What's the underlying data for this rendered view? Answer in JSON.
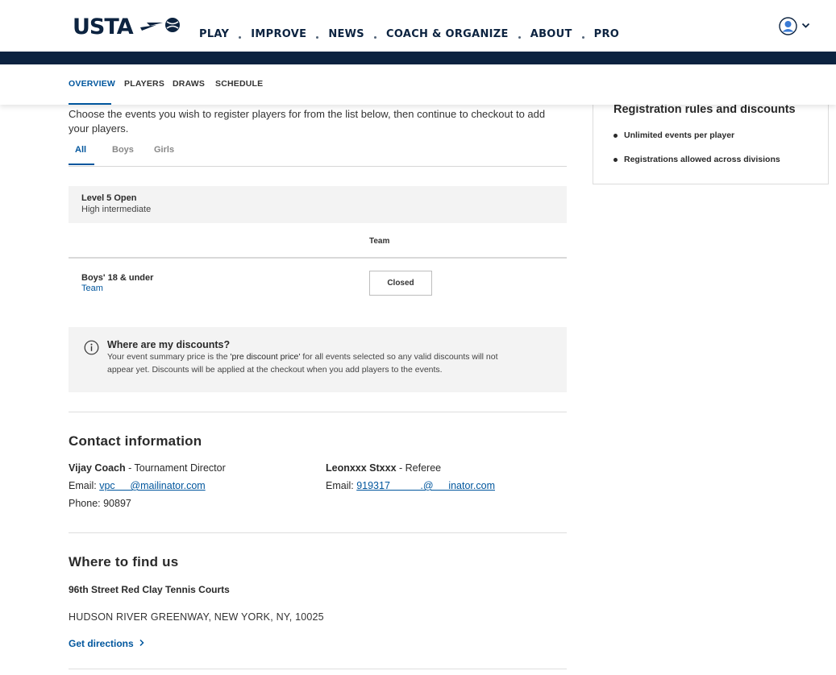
{
  "brand": {
    "logo_text": "USTA"
  },
  "header": {
    "nav": [
      "PLAY",
      "IMPROVE",
      "NEWS",
      "COACH & ORGANIZE",
      "ABOUT",
      "PRO"
    ]
  },
  "subnav": {
    "items": [
      "OVERVIEW",
      "PLAYERS",
      "DRAWS",
      "SCHEDULE"
    ],
    "active": "OVERVIEW"
  },
  "intro": {
    "text": "Choose the events you wish to register players for from the list below, then continue to checkout to add your players."
  },
  "tabs": {
    "items": [
      "All",
      "Boys",
      "Girls"
    ],
    "active": "All"
  },
  "level": {
    "name": "Level 5 Open",
    "description": "High intermediate"
  },
  "events_table": {
    "column_header": "Team",
    "rows": [
      {
        "name": "Boys' 18 & under",
        "type": "Team",
        "action": "Closed"
      }
    ]
  },
  "discount_notice": {
    "title": "Where are my discounts?",
    "body_prefix": "Your event summary price is the ",
    "body_emphasis": "'pre discount price'",
    "body_suffix": " for all events selected so any valid discounts will not appear yet. Discounts will be applied at the checkout when you add players to the events."
  },
  "contact": {
    "title": "Contact information",
    "people": [
      {
        "name": "Vijay Coach",
        "role": " - Tournament Director",
        "email_label": "Email: ",
        "email": "vpc   @mailinator.com",
        "phone_label": "Phone: ",
        "phone": "90897  "
      },
      {
        "name": "Leonxxx Stxxx",
        "role": " - Referee",
        "email_label": "Email: ",
        "email": "919317   .@   inator.com"
      }
    ]
  },
  "location": {
    "title": "Where to find us",
    "venue": "96th Street Red Clay Tennis Courts",
    "address": "HUDSON RIVER GREENWAY, NEW YORK, NY, 10025",
    "directions_label": "Get directions"
  },
  "sidebar": {
    "title": "Registration rules and discounts",
    "items": [
      "Unlimited events per player",
      "Registrations allowed across divisions"
    ]
  },
  "colors": {
    "navy": "#0c2340",
    "accent_blue": "#00569d",
    "panel_grey": "#f3f3f3"
  },
  "icons": [
    "user-avatar-icon",
    "chevron-down-icon",
    "info-icon",
    "chevron-right-icon"
  ]
}
